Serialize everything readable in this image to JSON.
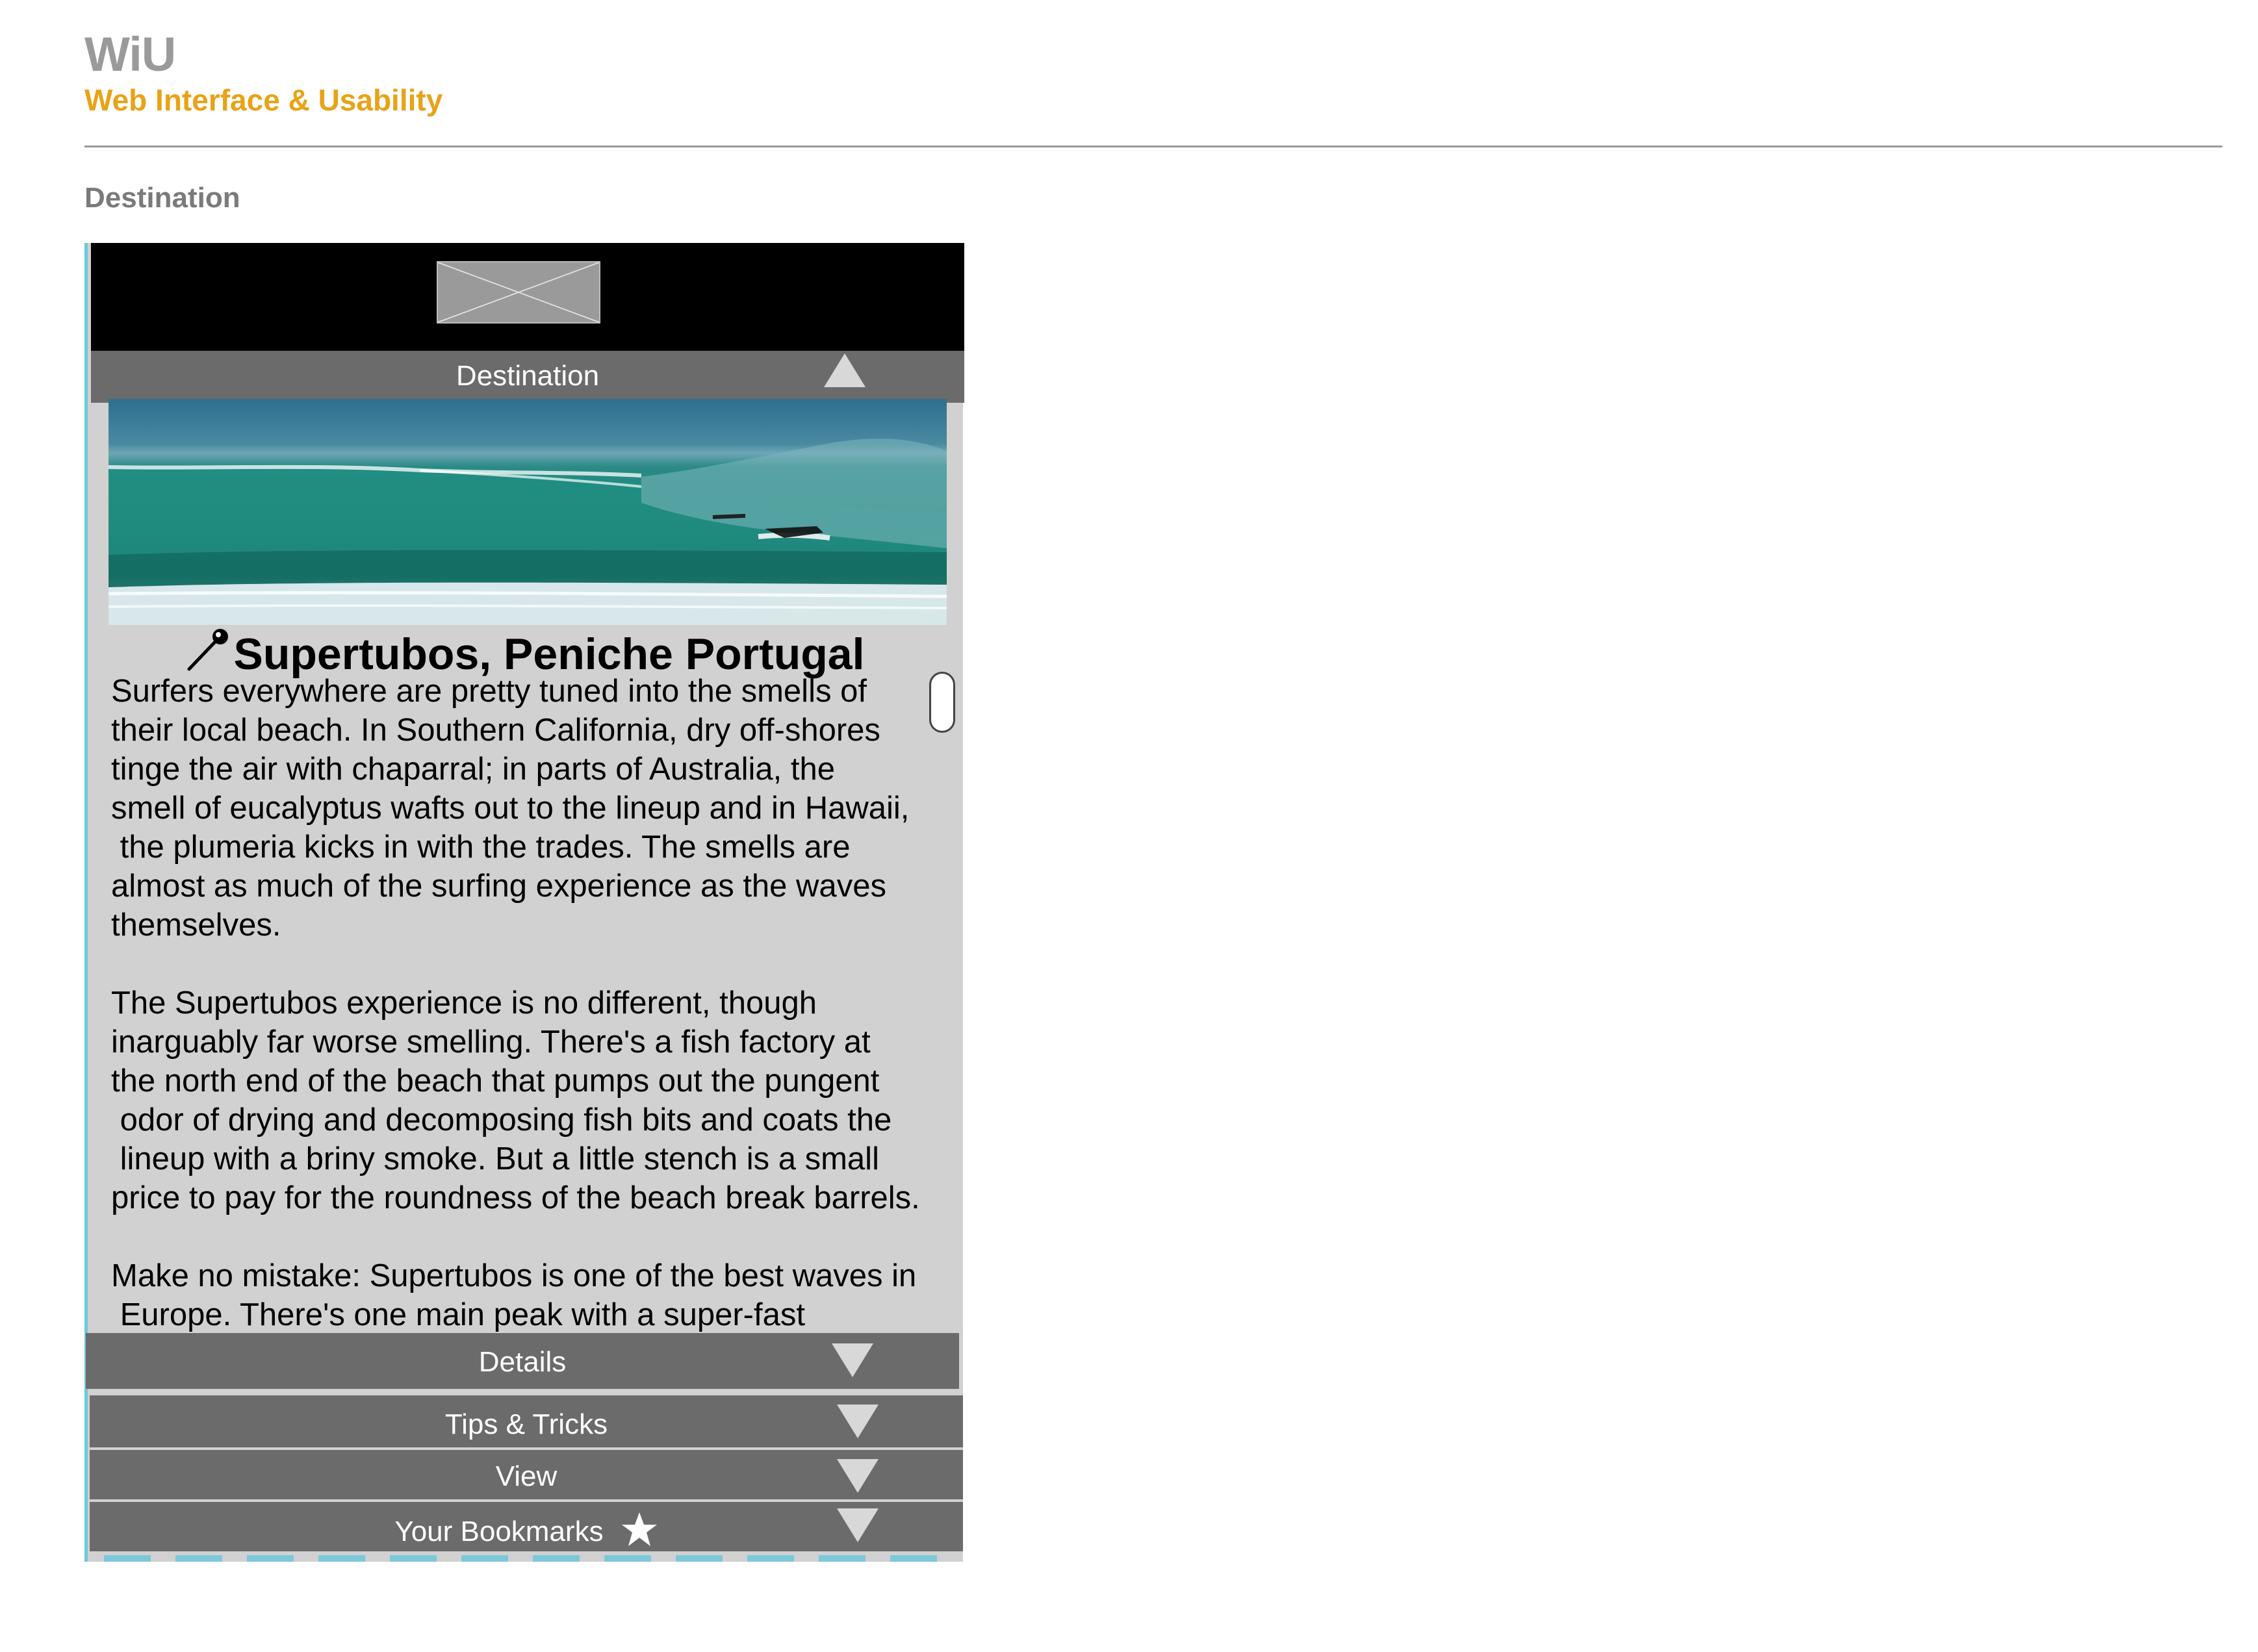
{
  "header": {
    "brand_title": "WiU",
    "brand_subtitle": "Web Interface & Usability",
    "page_heading": "Destination"
  },
  "colors": {
    "brand_accent": "#e8a317",
    "bar_gray": "#6b6b6b",
    "panel_gray": "#d1d1d1",
    "frame_cyan": "#6cc8dc"
  },
  "device": {
    "logo_icon": "image-placeholder-icon",
    "sections": {
      "destination": {
        "label": "Destination",
        "state": "expanded",
        "icon": "triangle-up-icon"
      },
      "details": {
        "label": "Details",
        "state": "collapsed",
        "icon": "triangle-down-icon"
      },
      "tips": {
        "label": "Tips & Tricks",
        "state": "collapsed",
        "icon": "triangle-down-icon"
      },
      "view": {
        "label": "View",
        "state": "collapsed",
        "icon": "triangle-down-icon"
      },
      "bookmarks": {
        "label": "Your Bookmarks",
        "state": "collapsed",
        "icon": "triangle-down-icon",
        "extra_icon": "star-icon"
      }
    },
    "hero_image": "surf-wave-photo",
    "place": {
      "icon": "map-pin-icon",
      "title": "Supertubos, Peniche Portugal"
    },
    "article_text": "Surfers everywhere are pretty tuned into the smells of\ntheir local beach. In Southern California, dry off-shores\ntinge the air with chaparral; in parts of Australia, the\nsmell of eucalyptus wafts out to the lineup and in Hawaii,\n the plumeria kicks in with the trades. The smells are\nalmost as much of the surfing experience as the waves\nthemselves.\n\nThe Supertubos experience is no different, though\ninarguably far worse smelling. There's a fish factory at\nthe north end of the beach that pumps out the pungent\n odor of drying and decomposing fish bits and coats the\n lineup with a briny smoke. But a little stench is a small\nprice to pay for the roundness of the beach break barrels.\n\nMake no mistake: Supertubos is one of the best waves in\n Europe. There's one main peak with a super-fast"
  }
}
